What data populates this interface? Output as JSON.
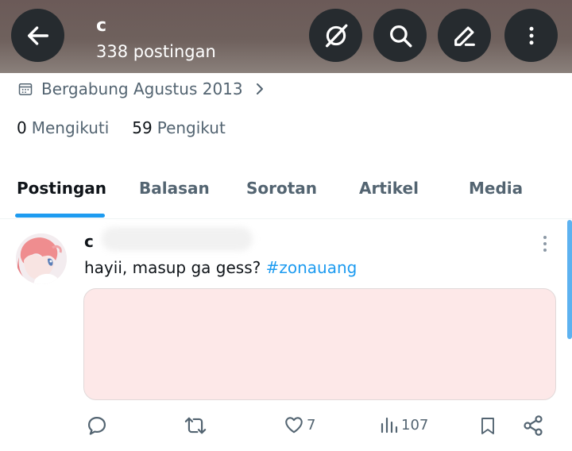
{
  "header": {
    "profile_name": "c",
    "post_count": "338 postingan",
    "icons": [
      "back-arrow-icon",
      "grok-icon",
      "search-icon",
      "edit-icon",
      "more-vertical-icon"
    ]
  },
  "profile": {
    "joined": "Bergabung Agustus 2013",
    "following_count": "0",
    "following_label": "Mengikuti",
    "followers_count": "59",
    "followers_label": "Pengikut"
  },
  "tabs": [
    {
      "label": "Postingan",
      "active": true
    },
    {
      "label": "Balasan",
      "active": false
    },
    {
      "label": "Sorotan",
      "active": false
    },
    {
      "label": "Artikel",
      "active": false
    },
    {
      "label": "Media",
      "active": false
    }
  ],
  "post": {
    "author": "c",
    "text": "hayii, masup ga gess? ",
    "hashtag": "#zonauang",
    "likes": "7",
    "views": "107"
  },
  "colors": {
    "accent": "#1d9bf0",
    "header_bg": "#6b5a58",
    "secondary_text": "#536471",
    "media_bg": "#fde8e8"
  }
}
